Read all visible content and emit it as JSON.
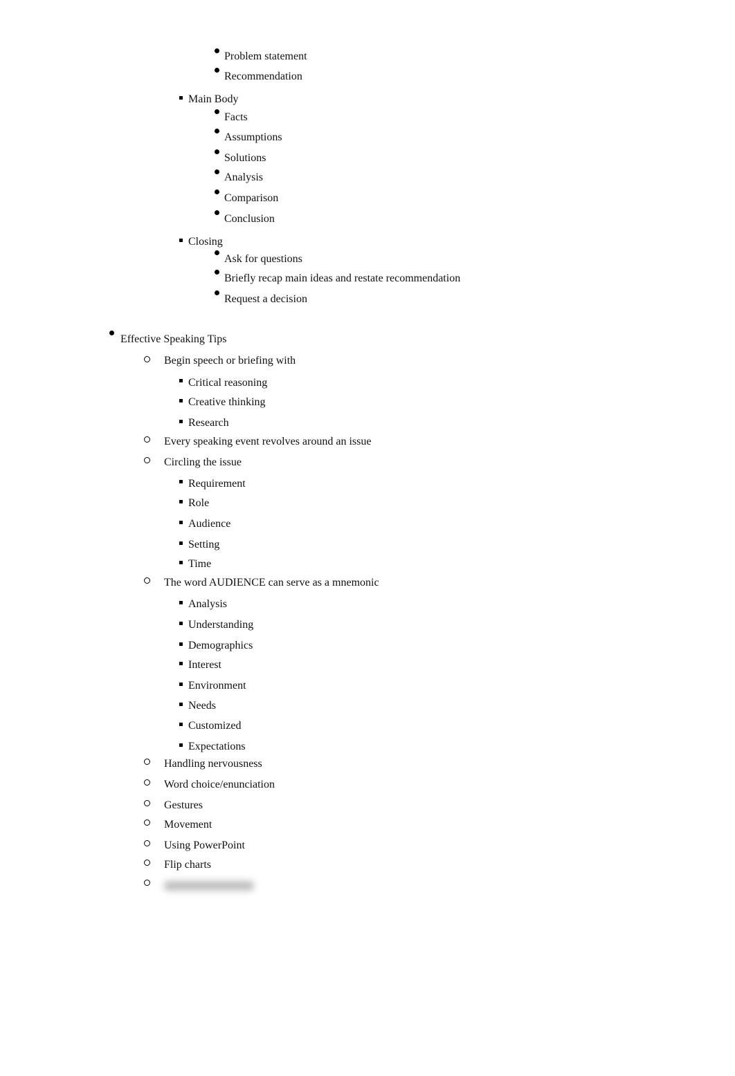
{
  "outline": {
    "opening_tail": [
      "Problem statement",
      "Recommendation"
    ],
    "main_body": {
      "label": "Main Body",
      "items": [
        "Facts",
        "Assumptions",
        "Solutions",
        "Analysis",
        "Comparison",
        "Conclusion"
      ]
    },
    "closing": {
      "label": "Closing",
      "items": [
        "Ask for questions",
        "Briefly recap main ideas and restate recommendation",
        "Request a decision"
      ]
    },
    "effective_speaking": {
      "label": "Effective Speaking Tips",
      "begin": {
        "label": "Begin speech or briefing with",
        "items": [
          "Critical reasoning",
          "Creative thinking",
          "Research"
        ]
      },
      "issue": "Every speaking event revolves around an issue",
      "circling": {
        "label": "Circling the issue",
        "items": [
          "Requirement",
          "Role",
          "Audience",
          "Setting",
          "Time"
        ]
      },
      "mnemonic": {
        "label": "The word AUDIENCE can serve as a mnemonic",
        "items": [
          "Analysis",
          "Understanding",
          "Demographics",
          "Interest",
          "Environment",
          "Needs",
          "Customized",
          "Expectations"
        ]
      },
      "tips": [
        "Handling nervousness",
        "Word choice/enunciation",
        "Gestures",
        "Movement",
        "Using PowerPoint",
        "Flip charts"
      ]
    }
  }
}
